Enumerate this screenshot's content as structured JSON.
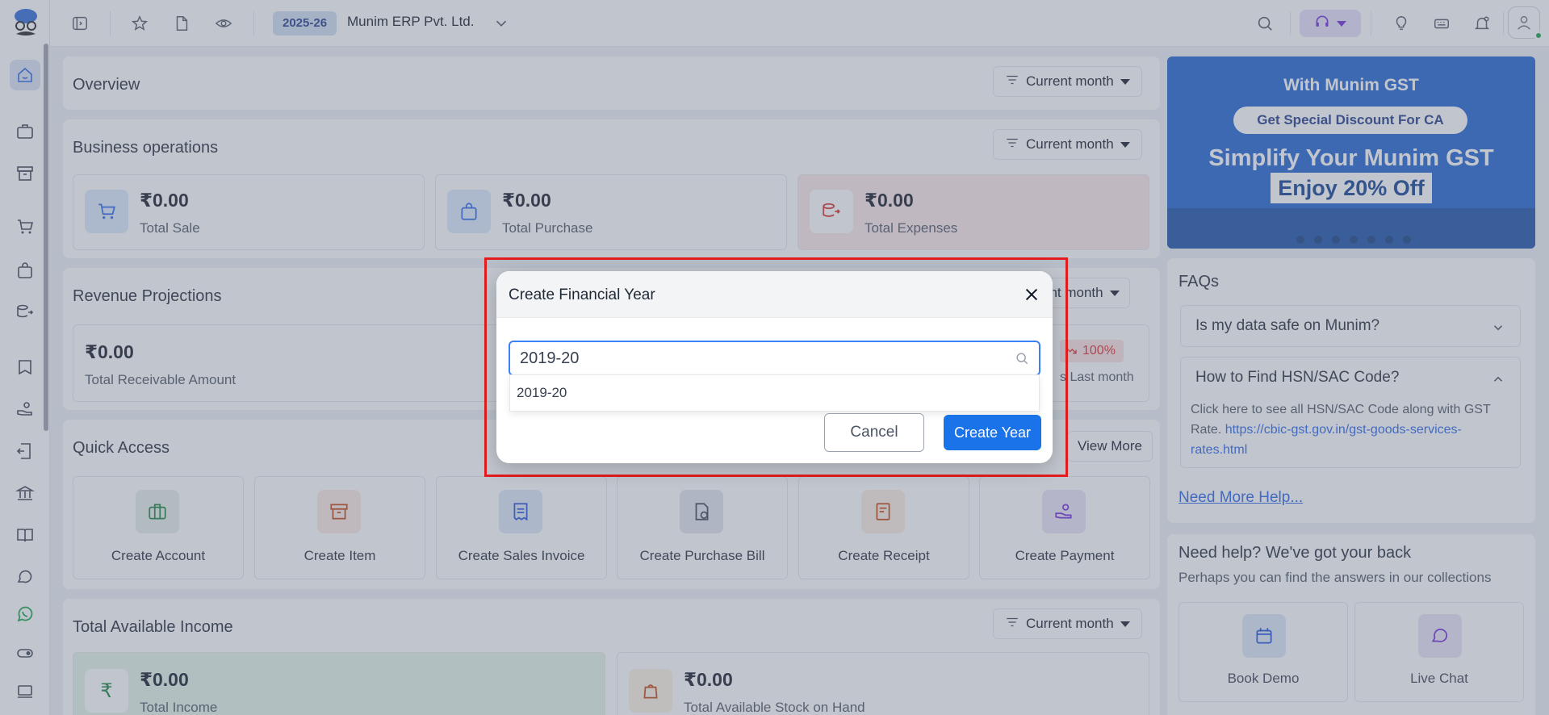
{
  "topbar": {
    "financial_year": "2025-26",
    "company_name": "Munim ERP Pvt. Ltd."
  },
  "overview": {
    "title": "Overview",
    "filter": "Current month"
  },
  "business_operations": {
    "title": "Business operations",
    "filter": "Current month",
    "stats": [
      {
        "value": "₹0.00",
        "label": "Total Sale"
      },
      {
        "value": "₹0.00",
        "label": "Total Purchase"
      },
      {
        "value": "₹0.00",
        "label": "Total Expenses"
      }
    ]
  },
  "revenue": {
    "title": "Revenue Projections",
    "filter_partial": "ent month",
    "receivable_value": "₹0.00",
    "receivable_label": "Total Receivable Amount",
    "change_pct": "100%",
    "compare_partial": "s Last month"
  },
  "quick_access": {
    "title": "Quick Access",
    "view_more_partial": "View More",
    "items": [
      {
        "label": "Create Account"
      },
      {
        "label": "Create Item"
      },
      {
        "label": "Create Sales Invoice"
      },
      {
        "label": "Create Purchase Bill"
      },
      {
        "label": "Create Receipt"
      },
      {
        "label": "Create Payment"
      }
    ]
  },
  "income": {
    "title": "Total Available Income",
    "filter": "Current month",
    "income_value": "₹0.00",
    "income_label": "Total Income",
    "stock_value": "₹0.00",
    "stock_label": "Total Available Stock on Hand"
  },
  "promo": {
    "line1": "With Munim GST",
    "pill": "Get Special Discount For CA",
    "line2": "Simplify Your Munim GST",
    "line3": "Enjoy 20% Off"
  },
  "faqs": {
    "title": "FAQs",
    "q1": "Is my data safe on Munim?",
    "q2": "How to Find HSN/SAC Code?",
    "a2_text": "Click here to see all HSN/SAC Code along with GST Rate.",
    "a2_link": "https://cbic-gst.gov.in/gst-goods-services-rates.html",
    "more_help": "Need More Help..."
  },
  "help": {
    "title": "Need help? We've got your back",
    "subtitle": "Perhaps you can find the answers in our collections",
    "tile1": "Book Demo",
    "tile2": "Live Chat"
  },
  "modal": {
    "title": "Create Financial Year",
    "input_value": "2019-20",
    "suggestion": "2019-20",
    "cancel_label": "Cancel",
    "create_label": "Create Year"
  },
  "colors": {
    "primary": "#1a73e8",
    "highlight_border": "#e11d1d",
    "overlay": "rgba(108,117,135,0.42)"
  }
}
